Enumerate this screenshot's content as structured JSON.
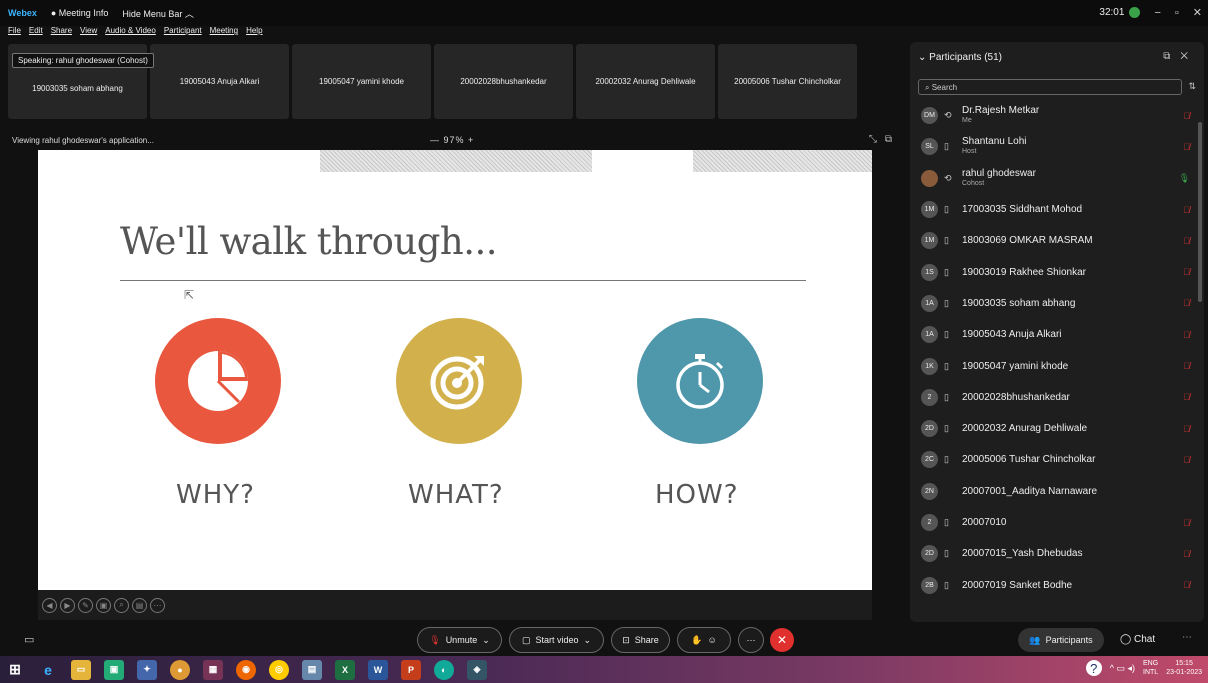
{
  "titlebar": {
    "app": "Webex",
    "meeting_info": "Meeting Info",
    "hide_menu": "Hide Menu Bar ︿",
    "timer": "32:01"
  },
  "menu": [
    "File",
    "Edit",
    "Share",
    "View",
    "Audio & Video",
    "Participant",
    "Meeting",
    "Help"
  ],
  "speaking": "Speaking: rahul ghodeswar (Cohost)",
  "tiles": [
    "19003035 soham abhang",
    "19005043 Anuja Alkari",
    "19005047 yamini khode",
    "20002028bhushankedar",
    "20002032 Anurag Dehliwale",
    "20005006 Tushar Chincholkar"
  ],
  "viewing": "Viewing rahul ghodeswar's application...",
  "zoom": "—  97%  +",
  "slide": {
    "title": "We'll walk through...",
    "labels": [
      "WHY?",
      "WHAT?",
      "HOW?"
    ],
    "colors": [
      "#e9573f",
      "#d2b04c",
      "#4f97ab"
    ]
  },
  "participants": {
    "header": "Participants (51)",
    "search_placeholder": "Search",
    "list": [
      {
        "initials": "DM",
        "name": "Dr.Rajesh Metkar",
        "sub": "Me",
        "mic": "muted"
      },
      {
        "initials": "SL",
        "name": "Shantanu Lohi",
        "sub": "Host",
        "mic": "muted"
      },
      {
        "initials": "",
        "name": "rahul ghodeswar",
        "sub": "Cohost",
        "mic": "on"
      },
      {
        "initials": "1M",
        "name": "17003035 Siddhant Mohod",
        "sub": "",
        "mic": "muted"
      },
      {
        "initials": "1M",
        "name": "18003069 OMKAR MASRAM",
        "sub": "",
        "mic": "muted"
      },
      {
        "initials": "1S",
        "name": "19003019 Rakhee Shionkar",
        "sub": "",
        "mic": "muted"
      },
      {
        "initials": "1A",
        "name": "19003035 soham abhang",
        "sub": "",
        "mic": "muted"
      },
      {
        "initials": "1A",
        "name": "19005043 Anuja Alkari",
        "sub": "",
        "mic": "muted"
      },
      {
        "initials": "1K",
        "name": "19005047 yamini khode",
        "sub": "",
        "mic": "muted"
      },
      {
        "initials": "2",
        "name": "20002028bhushankedar",
        "sub": "",
        "mic": "muted"
      },
      {
        "initials": "2D",
        "name": "20002032 Anurag Dehliwale",
        "sub": "",
        "mic": "muted"
      },
      {
        "initials": "2C",
        "name": "20005006 Tushar Chincholkar",
        "sub": "",
        "mic": "muted"
      },
      {
        "initials": "2N",
        "name": "20007001_Aaditya Narnaware",
        "sub": "",
        "mic": "none"
      },
      {
        "initials": "2",
        "name": "20007010",
        "sub": "",
        "mic": "muted"
      },
      {
        "initials": "2D",
        "name": "20007015_Yash Dhebudas",
        "sub": "",
        "mic": "muted"
      },
      {
        "initials": "2B",
        "name": "20007019 Sanket Bodhe",
        "sub": "",
        "mic": "muted"
      }
    ]
  },
  "controls": {
    "unmute": "Unmute",
    "start_video": "Start video",
    "share": "Share",
    "participants": "Participants",
    "chat": "Chat"
  },
  "tray": {
    "lang": "ENG",
    "layout": "INTL",
    "time": "15:15",
    "date": "23-01-2023"
  }
}
